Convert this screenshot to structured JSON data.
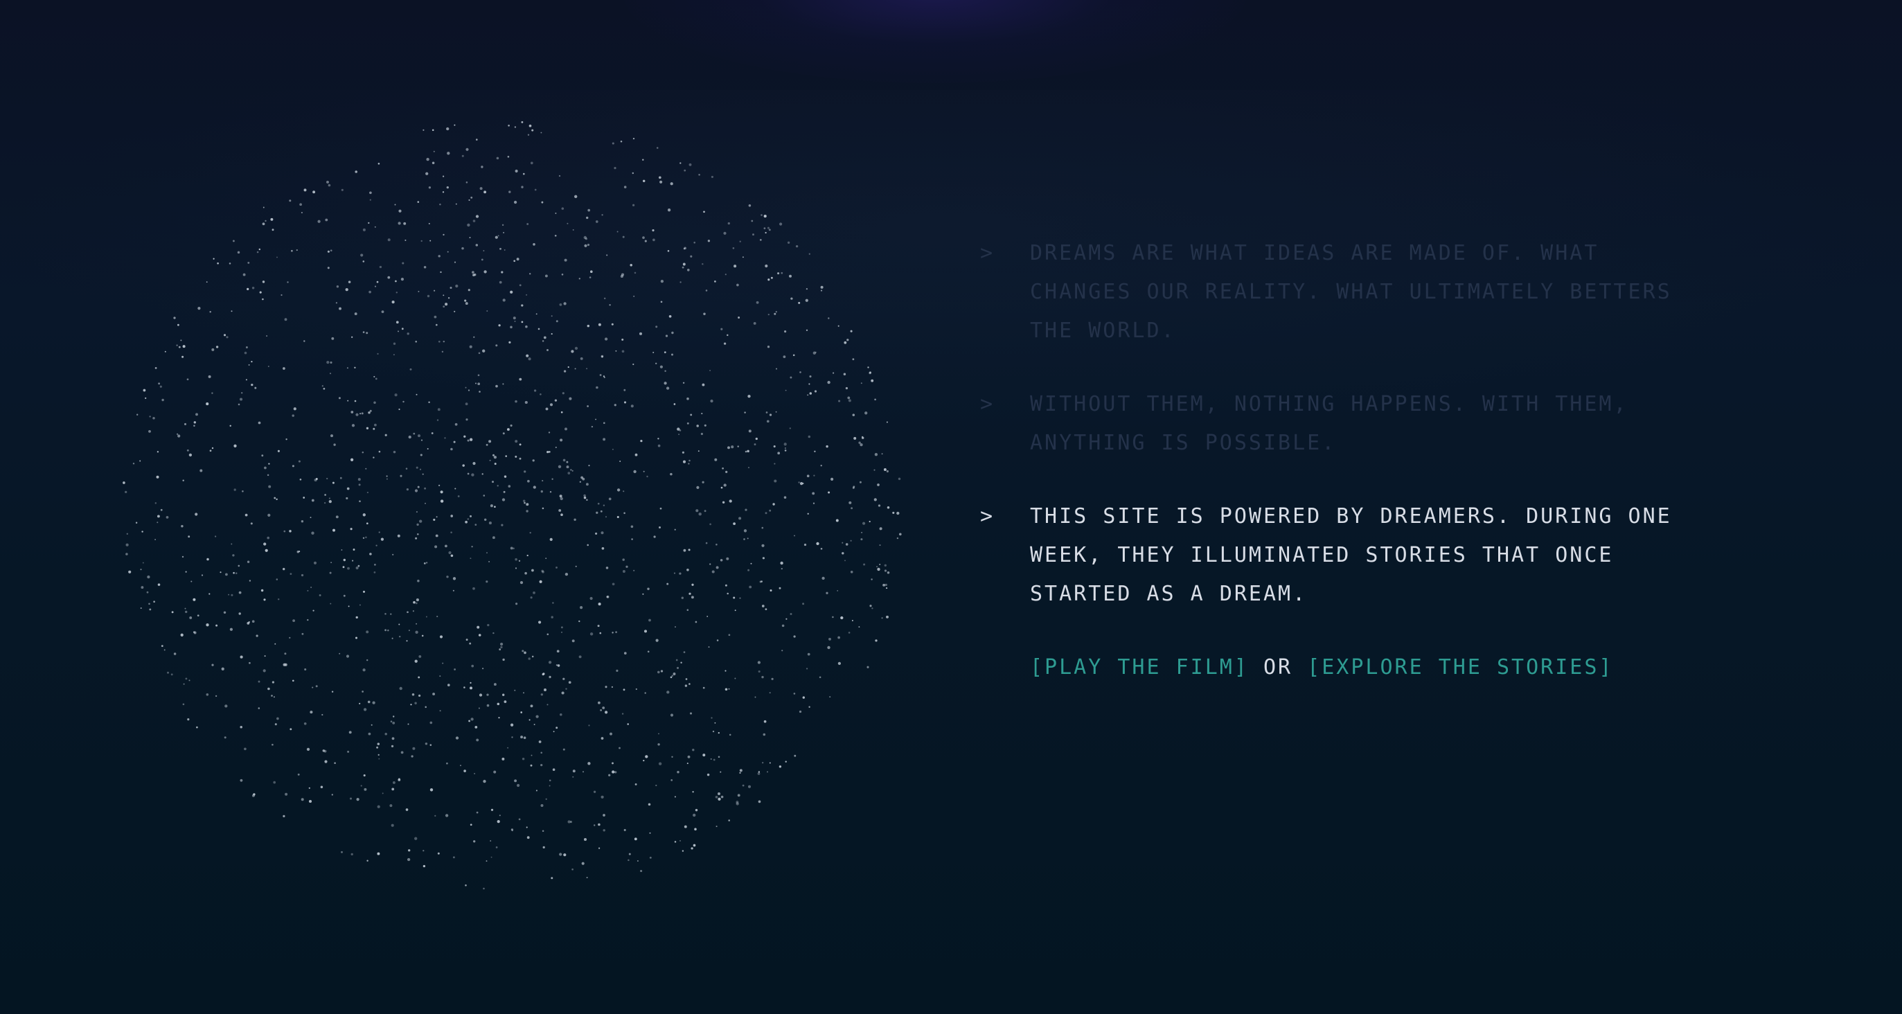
{
  "intro": {
    "paragraphs": [
      {
        "prompt": ">",
        "text": "DREAMS ARE WHAT IDEAS ARE MADE OF. WHAT CHANGES OUR REALITY. WHAT ULTIMATELY BETTERS THE WORLD."
      },
      {
        "prompt": ">",
        "text": "WITHOUT THEM, NOTHING HAPPENS. WITH THEM, ANYTHING IS POSSIBLE."
      },
      {
        "prompt": ">",
        "text": "THIS SITE IS POWERED BY DREAMERS. DURING ONE WEEK, THEY ILLUMINATED STORIES THAT ONCE STARTED AS A DREAM."
      }
    ]
  },
  "actions": {
    "play_label": "[PLAY THE FILM]",
    "separator": "OR",
    "explore_label": "[EXPLORE THE STORIES]"
  },
  "colors": {
    "background": "#061726",
    "dim_text": "#24324a",
    "active_text": "#d8dde6",
    "link": "#2e9c92",
    "particle": "#c8d2dc"
  }
}
